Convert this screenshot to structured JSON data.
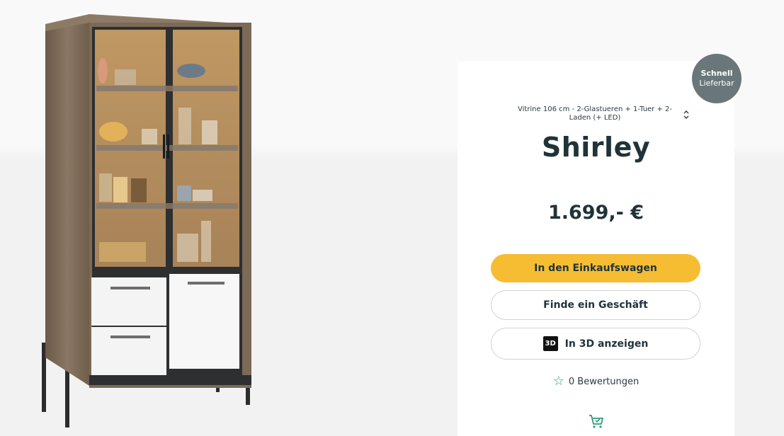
{
  "badge": {
    "line1": "Schnell",
    "line2": "Lieferbar"
  },
  "product": {
    "variant": "Vitrine 106 cm - 2-Glastueren + 1-Tuer + 2-Laden (+ LED)",
    "name": "Shirley",
    "price": "1.699,- €"
  },
  "buttons": {
    "cart": "In den Einkaufswagen",
    "store": "Finde ein Geschäft",
    "view3d": "In 3D anzeigen",
    "icon3d_text": "3D"
  },
  "reviews": {
    "text": "0 Bewertungen"
  },
  "icons": {
    "variant_toggle": "chevron-up-down-icon",
    "star": "star-outline-icon",
    "cart": "cart-icon"
  },
  "colors": {
    "accent": "#f6bd33",
    "badge": "#69777a",
    "star": "#2f9e77",
    "text": "#1f3339"
  }
}
